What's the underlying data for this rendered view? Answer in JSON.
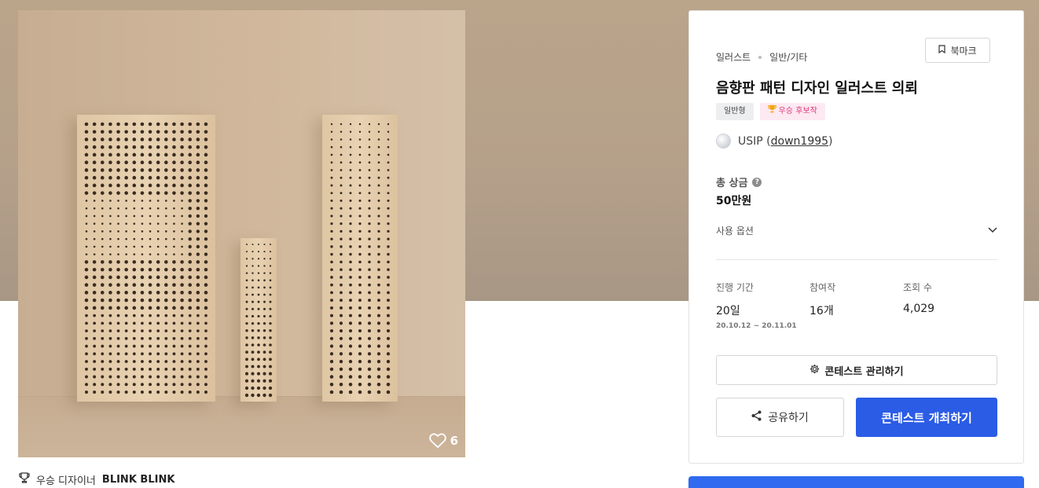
{
  "image": {
    "like_count": "6"
  },
  "winner": {
    "label": "우승 디자이너",
    "name": "BLINK BLINK"
  },
  "info": {
    "breadcrumb": [
      "일러스트",
      "일반/기타"
    ],
    "bookmark_label": "북마크",
    "title": "음향판 패턴 디자인 일러스트 의뢰",
    "tags": [
      "일반형",
      "우승 후보작"
    ],
    "host_name": "USIP",
    "host_handle": "down1995",
    "prize_label": "총 상금",
    "prize_value": "50만원",
    "usage_label": "사용 옵션",
    "stats": {
      "period_label": "진행 기간",
      "period_value": "20일",
      "period_start": "20.10.12",
      "period_end": "20.11.01",
      "entries_label": "참여작",
      "entries_value": "16개",
      "views_label": "조회 수",
      "views_value": "4,029"
    },
    "manage_label": "콘테스트 관리하기",
    "share_label": "공유하기",
    "host_contest_label": "콘테스트 개최하기"
  },
  "colors": {
    "accent": "#2b5ce6",
    "tag_pink": "#e0357a"
  }
}
